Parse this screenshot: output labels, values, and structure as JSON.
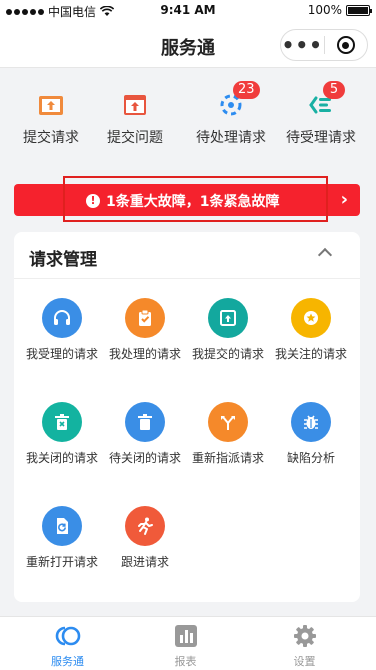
{
  "status_bar": {
    "carrier": "中国电信",
    "time": "9:41 AM",
    "battery": "100%",
    "battery_level": 1.0
  },
  "nav": {
    "title": "服务通",
    "more_icon": "more-dots-icon",
    "close_icon": "target-icon"
  },
  "quick_actions": [
    {
      "label": "提交请求",
      "icon": "upload-box-icon",
      "color": "#f08a3c"
    },
    {
      "label": "提交问题",
      "icon": "upload-window-icon",
      "color": "#e8553e"
    },
    {
      "label": "待处理请求",
      "icon": "loading-circle-icon",
      "color": "#2d8cf0",
      "badge": "23"
    },
    {
      "label": "待受理请求",
      "icon": "list-arrow-icon",
      "color": "#19b0a3",
      "badge": "5"
    }
  ],
  "alert": {
    "text": "1条重大故障，1条紧急故障",
    "icon": "exclamation-icon",
    "color": "#f5222d"
  },
  "panel": {
    "title": "请求管理",
    "items": [
      {
        "label": "我受理的请求",
        "icon": "headset-icon",
        "color": "#3a8ee6"
      },
      {
        "label": "我处理的请求",
        "icon": "clipboard-check-icon",
        "color": "#f5892a"
      },
      {
        "label": "我提交的请求",
        "icon": "upload-window-icon",
        "color": "#13a89e"
      },
      {
        "label": "我关注的请求",
        "icon": "star-icon",
        "color": "#f7b500"
      },
      {
        "label": "我关闭的请求",
        "icon": "trash-x-icon",
        "color": "#13b3a0"
      },
      {
        "label": "待关闭的请求",
        "icon": "trash-icon",
        "color": "#3a8ee6"
      },
      {
        "label": "重新指派请求",
        "icon": "split-arrow-icon",
        "color": "#f5892a"
      },
      {
        "label": "缺陷分析",
        "icon": "bug-icon",
        "color": "#3a8ee6"
      },
      {
        "label": "重新打开请求",
        "icon": "reopen-doc-icon",
        "color": "#3a8ee6"
      },
      {
        "label": "跟进请求",
        "icon": "running-person-icon",
        "color": "#f05a3a"
      }
    ]
  },
  "tabs": [
    {
      "label": "服务通",
      "icon": "service-logo-icon",
      "active": true
    },
    {
      "label": "报表",
      "icon": "bar-chart-icon",
      "active": false
    },
    {
      "label": "设置",
      "icon": "gear-icon",
      "active": false
    }
  ]
}
